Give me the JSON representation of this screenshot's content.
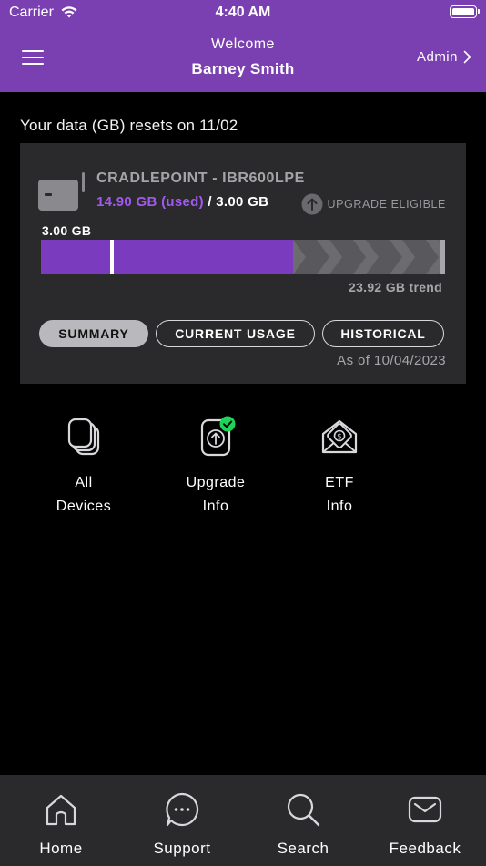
{
  "status_bar": {
    "carrier": "Carrier",
    "time": "4:40 AM"
  },
  "header": {
    "welcome": "Welcome",
    "user_name": "Barney Smith",
    "admin_label": "Admin",
    "background_color": "#7a3fb0"
  },
  "reset_notice": "Your data (GB) resets on 11/02",
  "device_card": {
    "device_name": "CRADLEPOINT - IBR600LPE",
    "used": "14.90 GB (used)",
    "total": "/ 3.00 GB",
    "upgrade_status": "UPGRADE ELIGIBLE",
    "limit_label": "3.00 GB",
    "usage_bar": {
      "used_gb": 14.9,
      "limit_gb": 3.0,
      "trend_gb": 23.92,
      "used_color": "#7b3bbf",
      "trend_color": "#6c6c70"
    },
    "trend": "23.92 GB trend",
    "tabs": [
      {
        "label": "SUMMARY",
        "active": true
      },
      {
        "label": "CURRENT USAGE",
        "active": false
      },
      {
        "label": "HISTORICAL",
        "active": false
      }
    ],
    "as_of": "As of 10/04/2023"
  },
  "quick_links": [
    {
      "line1": "All",
      "line2": "Devices",
      "icon": "devices-icon"
    },
    {
      "line1": "Upgrade",
      "line2": "Info",
      "icon": "upgrade-icon"
    },
    {
      "line1": "ETF",
      "line2": "Info",
      "icon": "etf-icon"
    }
  ],
  "bottom_nav": [
    {
      "label": "Home",
      "icon": "home-icon"
    },
    {
      "label": "Support",
      "icon": "chat-icon"
    },
    {
      "label": "Search",
      "icon": "search-icon"
    },
    {
      "label": "Feedback",
      "icon": "mail-icon"
    }
  ]
}
